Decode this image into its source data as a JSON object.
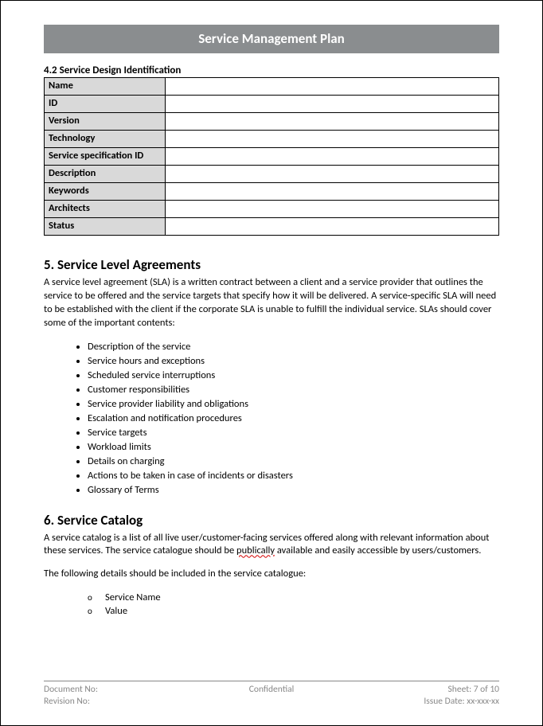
{
  "header": {
    "title": "Service Management Plan"
  },
  "section42": {
    "heading": "4.2 Service Design Identification",
    "rows": [
      {
        "label": "Name",
        "value": ""
      },
      {
        "label": "ID",
        "value": ""
      },
      {
        "label": "Version",
        "value": ""
      },
      {
        "label": "Technology",
        "value": ""
      },
      {
        "label": "Service specification ID",
        "value": ""
      },
      {
        "label": "Description",
        "value": ""
      },
      {
        "label": "Keywords",
        "value": ""
      },
      {
        "label": "Architects",
        "value": ""
      },
      {
        "label": "Status",
        "value": ""
      }
    ]
  },
  "section5": {
    "heading": "5.  Service Level Agreements",
    "intro": "A service level agreement (SLA) is a written contract between a client and a service provider that outlines the service to be offered and the service targets that specify how it will be delivered. A service-specific SLA will need to be established with the client if the corporate SLA is unable to fulfill the individual service. SLAs should cover some of the important contents:",
    "items": [
      "Description of the service",
      "Service hours and exceptions",
      "Scheduled service interruptions",
      "Customer responsibilities",
      "Service  provider liability and obligations",
      "Escalation and notification procedures",
      "Service targets",
      "Workload limits",
      "Details on charging",
      "Actions to be taken in case of incidents or disasters",
      "Glossary of Terms"
    ]
  },
  "section6": {
    "heading": "6.  Service Catalog",
    "intro_before": "A service catalog is a list of all live user/customer-facing services offered along with relevant information about these services. The service catalogue should be ",
    "intro_squiggle": "publically",
    "intro_after": " available and easily accessible by users/customers.",
    "intro2": "The following details should be included in the service catalogue:",
    "items": [
      "Service Name",
      "Value"
    ]
  },
  "footer": {
    "doc_no": "Document No:",
    "confidential": "Confidential",
    "sheet": "Sheet: 7 of 10",
    "rev_no": "Revision No:",
    "issue_date": "Issue Date: xx-xxx-xx"
  }
}
